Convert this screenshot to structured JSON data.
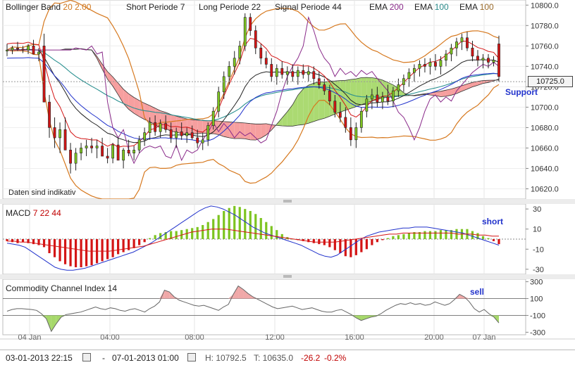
{
  "legend": {
    "bb_label": "Bollinger Band",
    "bb_params": "20  2.00",
    "short_label": "Short Periode",
    "short_val": "7",
    "long_label": "Long Periode",
    "long_val": "22",
    "signal_label": "Signal Periode",
    "signal_val": "44",
    "ema1_label": "EMA",
    "ema1_val": "200",
    "ema2_label": "EMA",
    "ema2_val": "100",
    "ema3_label": "EMA",
    "ema3_val": "100"
  },
  "notes": {
    "indicative": "Daten sind indikativ",
    "support": "Support",
    "short": "short",
    "sell": "sell"
  },
  "macd_title": {
    "label": "MACD",
    "p1": "7",
    "p2": "22",
    "p3": "44"
  },
  "cci_title": {
    "label": "Commodity Channel Index",
    "p": "14"
  },
  "current_price": "10725.0",
  "footer": {
    "from": "03-01-2013 22:15",
    "dash": "-",
    "to": "07-01-2013 01:00",
    "high": "H: 10792.5",
    "low": "T: 10635.0",
    "chg": "-26.2",
    "chg_pct": "-0.2%"
  },
  "colors": {
    "up": "#7dc420",
    "down": "#d41515",
    "ichimoku_green": "#a6d86a",
    "ichimoku_red": "#f59a9a",
    "bb": "#d6781e",
    "ema200": "#8a2a8a",
    "ema100": "#2a9090",
    "signal_blue": "#2233cc"
  },
  "chart_data": [
    {
      "type": "candlestick",
      "title": "",
      "ylim": [
        10610,
        10805
      ],
      "yticks": [
        "10800.0",
        "10780.0",
        "10760.0",
        "10740.0",
        "10720.0",
        "10700.0",
        "10680.0",
        "10660.0",
        "10640.0",
        "10620.0"
      ],
      "ytick_values": [
        10800,
        10780,
        10760,
        10740,
        10720,
        10700,
        10680,
        10660,
        10640,
        10620
      ],
      "xticks": [
        "04 Jan",
        "04:00",
        "08:00",
        "12:00",
        "16:00",
        "20:00",
        "07 Jan"
      ],
      "high": 10792.5,
      "low": 10635.0,
      "last": 10725.0,
      "ohlc": [
        [
          10755,
          10762,
          10750,
          10756
        ],
        [
          10756,
          10760,
          10752,
          10758
        ],
        [
          10758,
          10764,
          10755,
          10757
        ],
        [
          10757,
          10760,
          10753,
          10756
        ],
        [
          10756,
          10762,
          10752,
          10760
        ],
        [
          10760,
          10766,
          10755,
          10752
        ],
        [
          10752,
          10758,
          10745,
          10754
        ],
        [
          10760,
          10772,
          10730,
          10705
        ],
        [
          10705,
          10712,
          10670,
          10680
        ],
        [
          10680,
          10690,
          10660,
          10670
        ],
        [
          10670,
          10685,
          10655,
          10678
        ],
        [
          10678,
          10690,
          10665,
          10658
        ],
        [
          10658,
          10665,
          10635,
          10645
        ],
        [
          10645,
          10660,
          10638,
          10655
        ],
        [
          10655,
          10665,
          10648,
          10660
        ],
        [
          10660,
          10668,
          10652,
          10662
        ],
        [
          10662,
          10670,
          10655,
          10660
        ],
        [
          10660,
          10668,
          10650,
          10662
        ],
        [
          10662,
          10670,
          10655,
          10652
        ],
        [
          10652,
          10660,
          10645,
          10650
        ],
        [
          10650,
          10665,
          10645,
          10663
        ],
        [
          10663,
          10670,
          10655,
          10648
        ],
        [
          10648,
          10660,
          10640,
          10658
        ],
        [
          10658,
          10668,
          10652,
          10655
        ],
        [
          10655,
          10662,
          10648,
          10658
        ],
        [
          10658,
          10672,
          10655,
          10668
        ],
        [
          10668,
          10680,
          10662,
          10675
        ],
        [
          10675,
          10690,
          10668,
          10685
        ],
        [
          10685,
          10692,
          10672,
          10676
        ],
        [
          10676,
          10688,
          10670,
          10684
        ],
        [
          10684,
          10692,
          10675,
          10678
        ],
        [
          10678,
          10685,
          10665,
          10670
        ],
        [
          10670,
          10680,
          10660,
          10676
        ],
        [
          10676,
          10685,
          10668,
          10672
        ],
        [
          10672,
          10680,
          10665,
          10675
        ],
        [
          10675,
          10682,
          10668,
          10670
        ],
        [
          10670,
          10678,
          10660,
          10665
        ],
        [
          10665,
          10675,
          10658,
          10668
        ],
        [
          10668,
          10685,
          10662,
          10682
        ],
        [
          10682,
          10700,
          10678,
          10696
        ],
        [
          10696,
          10720,
          10690,
          10715
        ],
        [
          10715,
          10735,
          10708,
          10730
        ],
        [
          10730,
          10745,
          10722,
          10740
        ],
        [
          10740,
          10755,
          10732,
          10748
        ],
        [
          10748,
          10765,
          10742,
          10760
        ],
        [
          10760,
          10792,
          10755,
          10788
        ],
        [
          10788,
          10792,
          10770,
          10775
        ],
        [
          10775,
          10780,
          10752,
          10758
        ],
        [
          10758,
          10762,
          10742,
          10748
        ],
        [
          10748,
          10755,
          10738,
          10742
        ],
        [
          10742,
          10748,
          10725,
          10730
        ],
        [
          10730,
          10742,
          10722,
          10738
        ],
        [
          10738,
          10745,
          10728,
          10732
        ],
        [
          10732,
          10740,
          10722,
          10735
        ],
        [
          10735,
          10742,
          10725,
          10730
        ],
        [
          10730,
          10740,
          10722,
          10736
        ],
        [
          10736,
          10742,
          10728,
          10732
        ],
        [
          10732,
          10740,
          10725,
          10735
        ],
        [
          10735,
          10740,
          10722,
          10728
        ],
        [
          10728,
          10735,
          10718,
          10722
        ],
        [
          10722,
          10728,
          10712,
          10716
        ],
        [
          10716,
          10722,
          10702,
          10706
        ],
        [
          10706,
          10712,
          10690,
          10695
        ],
        [
          10695,
          10705,
          10685,
          10690
        ],
        [
          10690,
          10700,
          10675,
          10680
        ],
        [
          10680,
          10690,
          10662,
          10668
        ],
        [
          10668,
          10685,
          10660,
          10680
        ],
        [
          10680,
          10700,
          10675,
          10696
        ],
        [
          10696,
          10712,
          10690,
          10708
        ],
        [
          10708,
          10718,
          10698,
          10712
        ],
        [
          10712,
          10720,
          10700,
          10705
        ],
        [
          10705,
          10715,
          10698,
          10710
        ],
        [
          10710,
          10722,
          10702,
          10706
        ],
        [
          10706,
          10720,
          10700,
          10716
        ],
        [
          10716,
          10728,
          10710,
          10722
        ],
        [
          10722,
          10732,
          10715,
          10728
        ],
        [
          10728,
          10738,
          10720,
          10734
        ],
        [
          10734,
          10742,
          10725,
          10738
        ],
        [
          10738,
          10746,
          10730,
          10742
        ],
        [
          10742,
          10748,
          10734,
          10740
        ],
        [
          10740,
          10748,
          10732,
          10744
        ],
        [
          10744,
          10752,
          10736,
          10740
        ],
        [
          10740,
          10750,
          10732,
          10746
        ],
        [
          10746,
          10756,
          10740,
          10752
        ],
        [
          10752,
          10762,
          10745,
          10758
        ],
        [
          10758,
          10768,
          10750,
          10764
        ],
        [
          10764,
          10772,
          10756,
          10768
        ],
        [
          10768,
          10774,
          10755,
          10758
        ],
        [
          10758,
          10765,
          10745,
          10750
        ],
        [
          10750,
          10756,
          10740,
          10746
        ],
        [
          10746,
          10752,
          10738,
          10748
        ],
        [
          10748,
          10752,
          10738,
          10744
        ],
        [
          10744,
          10750,
          10740,
          10746
        ],
        [
          10762,
          10770,
          10725,
          10730
        ]
      ]
    },
    {
      "type": "bar",
      "title": "MACD  7  22  44",
      "ylim": [
        -35,
        35
      ],
      "yticks": [
        "30",
        "10",
        "-10",
        "-30"
      ],
      "ytick_values": [
        30,
        10,
        -10,
        -30
      ],
      "values": [
        -2,
        -3,
        -4,
        -3,
        -4,
        -5,
        -6,
        -8,
        -14,
        -18,
        -22,
        -25,
        -27,
        -28,
        -28,
        -27,
        -26,
        -24,
        -22,
        -20,
        -18,
        -15,
        -13,
        -11,
        -9,
        -6,
        -3,
        1,
        4,
        6,
        7,
        8,
        8,
        9,
        10,
        11,
        12,
        14,
        17,
        20,
        24,
        28,
        31,
        33,
        32,
        30,
        28,
        25,
        21,
        17,
        13,
        9,
        5,
        2,
        0,
        -1,
        -2,
        -3,
        -4,
        -5,
        -6,
        -8,
        -11,
        -14,
        -17,
        -18,
        -16,
        -13,
        -10,
        -6,
        -3,
        -1,
        1,
        3,
        4,
        5,
        6,
        7,
        7,
        8,
        8,
        8,
        9,
        9,
        9,
        10,
        10,
        10,
        8,
        6,
        3,
        1,
        -2,
        -5
      ],
      "macd_line": [
        -4,
        -5,
        -6,
        -8,
        -12,
        -16,
        -20,
        -24,
        -28,
        -30,
        -31,
        -31,
        -30,
        -29,
        -27,
        -25,
        -23,
        -21,
        -19,
        -17,
        -15,
        -13,
        -10,
        -7,
        -4,
        0,
        4,
        8,
        12,
        16,
        20,
        24,
        28,
        31,
        33,
        32,
        30,
        27,
        24,
        20,
        16,
        12,
        9,
        6,
        4,
        2,
        0,
        -2,
        -4,
        -6,
        -9,
        -12,
        -15,
        -17,
        -18,
        -16,
        -12,
        -8,
        -4,
        0,
        3,
        5,
        7,
        8,
        9,
        10,
        11,
        11,
        12,
        12,
        12,
        11,
        10,
        9,
        8,
        7,
        6,
        4,
        2,
        0,
        -2,
        -4,
        -6
      ],
      "signal_line": [
        -2,
        -2,
        -3,
        -3,
        -4,
        -5,
        -6,
        -7,
        -8,
        -9,
        -10,
        -11,
        -12,
        -12,
        -12,
        -12,
        -11,
        -10,
        -9,
        -8,
        -7,
        -5,
        -3,
        -1,
        1,
        3,
        5,
        7,
        8,
        9,
        10,
        10,
        10,
        9,
        8,
        7,
        6,
        5,
        4,
        3,
        2,
        1,
        0,
        -1,
        -2,
        -3,
        -3,
        -3,
        -3,
        -2,
        -1,
        0,
        1,
        2,
        3,
        4,
        5,
        5,
        6,
        6,
        6,
        6,
        6,
        6,
        6,
        6,
        5,
        5,
        5,
        4,
        4,
        3,
        3
      ]
    },
    {
      "type": "area",
      "title": "Commodity Channel Index  14",
      "ylim": [
        -330,
        330
      ],
      "yticks": [
        "300",
        "100",
        "-100",
        "-300"
      ],
      "ytick_values": [
        300,
        100,
        -100,
        -300
      ],
      "values": [
        -50,
        -30,
        -20,
        -20,
        -25,
        -30,
        -40,
        -80,
        -140,
        -290,
        -200,
        -120,
        -90,
        -80,
        -70,
        -60,
        -40,
        -20,
        0,
        -20,
        -30,
        -10,
        -20,
        -40,
        -50,
        -30,
        -20,
        -40,
        -60,
        -20,
        10,
        60,
        200,
        180,
        120,
        80,
        60,
        40,
        20,
        10,
        20,
        0,
        -20,
        -40,
        0,
        30,
        150,
        250,
        210,
        160,
        120,
        90,
        60,
        30,
        0,
        -20,
        -10,
        0,
        10,
        -10,
        -30,
        -20,
        -10,
        -30,
        -50,
        -60,
        -60,
        -40,
        -30,
        -60,
        -90,
        -130,
        -160,
        -140,
        -120,
        -110,
        -80,
        -40,
        -10,
        20,
        40,
        30,
        50,
        30,
        40,
        20,
        30,
        60,
        40,
        20,
        40,
        90,
        150,
        120,
        60,
        -20,
        -60,
        -30,
        -80,
        -120,
        -190
      ]
    }
  ]
}
